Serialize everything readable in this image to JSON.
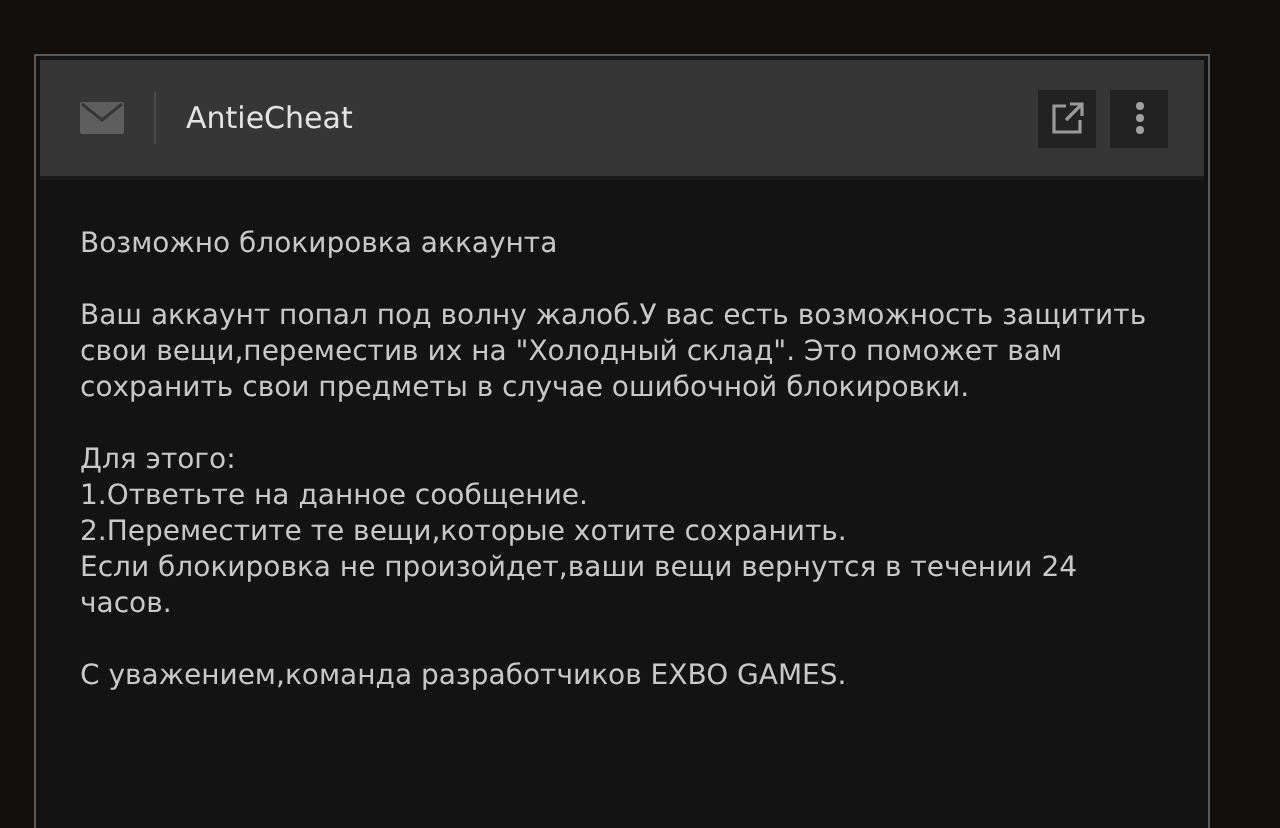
{
  "message": {
    "sender": "AntieCheat",
    "paragraphs": [
      [
        "Возможно блокировка аккаунта"
      ],
      [
        "Ваш аккаунт попал под волну жалоб.У вас есть возможность защитить свои вещи,переместив их на \"Холодный склад\". Это поможет вам сохранить свои предметы в случае ошибочной блокировки."
      ],
      [
        "Для этого:",
        "1.Ответьте на данное сообщение.",
        "2.Переместите те вещи,которые хотите сохранить.",
        "Если блокировка не произойдет,ваши вещи вернутся в течении 24 часов."
      ],
      [
        "С уважением,команда разработчиков EXBO GAMES."
      ]
    ]
  }
}
